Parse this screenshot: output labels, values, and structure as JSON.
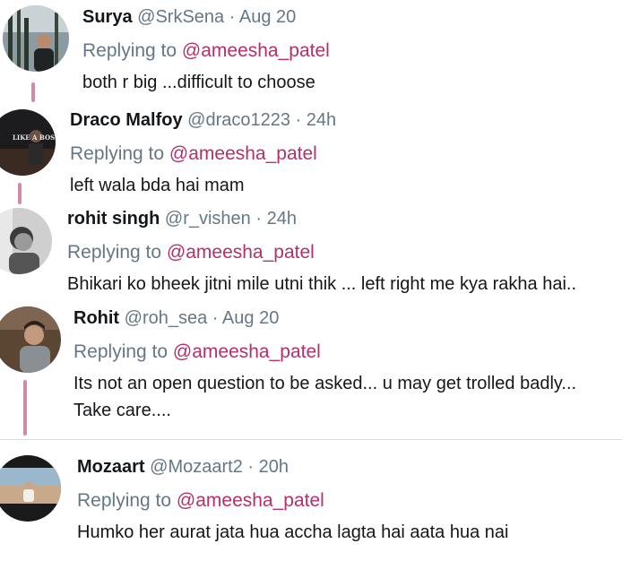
{
  "tweets": [
    {
      "name": "Surya",
      "handle": "@SrkSena",
      "sep": "·",
      "time": "Aug 20",
      "replying_prefix": "Replying to",
      "mention": "@ameesha_patel",
      "text": "both r big ...difficult to choose"
    },
    {
      "name": "Draco Malfoy",
      "handle": "@draco1223",
      "sep": "·",
      "time": "24h",
      "replying_prefix": "Replying to",
      "mention": "@ameesha_patel",
      "text": "left wala bda hai mam",
      "avatar_caption": "LIKE A BOSS"
    },
    {
      "name": "rohit singh",
      "handle": "@r_vishen",
      "sep": "·",
      "time": "24h",
      "replying_prefix": "Replying to",
      "mention": "@ameesha_patel",
      "text": "Bhikari ko bheek jitni mile utni thik ... left right me kya rakha hai.."
    },
    {
      "name": "Rohit",
      "handle": "@roh_sea",
      "sep": "·",
      "time": "Aug 20",
      "replying_prefix": "Replying to",
      "mention": "@ameesha_patel",
      "text": "Its not an open question to be asked... u may get trolled badly...\nTake care...."
    },
    {
      "name": "Mozaart",
      "handle": "@Mozaart2",
      "sep": "·",
      "time": "20h",
      "replying_prefix": "Replying to",
      "mention": "@ameesha_patel",
      "text": "Humko her aurat jata hua accha lagta hai aata hua nai"
    }
  ],
  "colors": {
    "mention": "#b5306b",
    "meta": "#657786",
    "thread_line": "#d18aa9"
  }
}
